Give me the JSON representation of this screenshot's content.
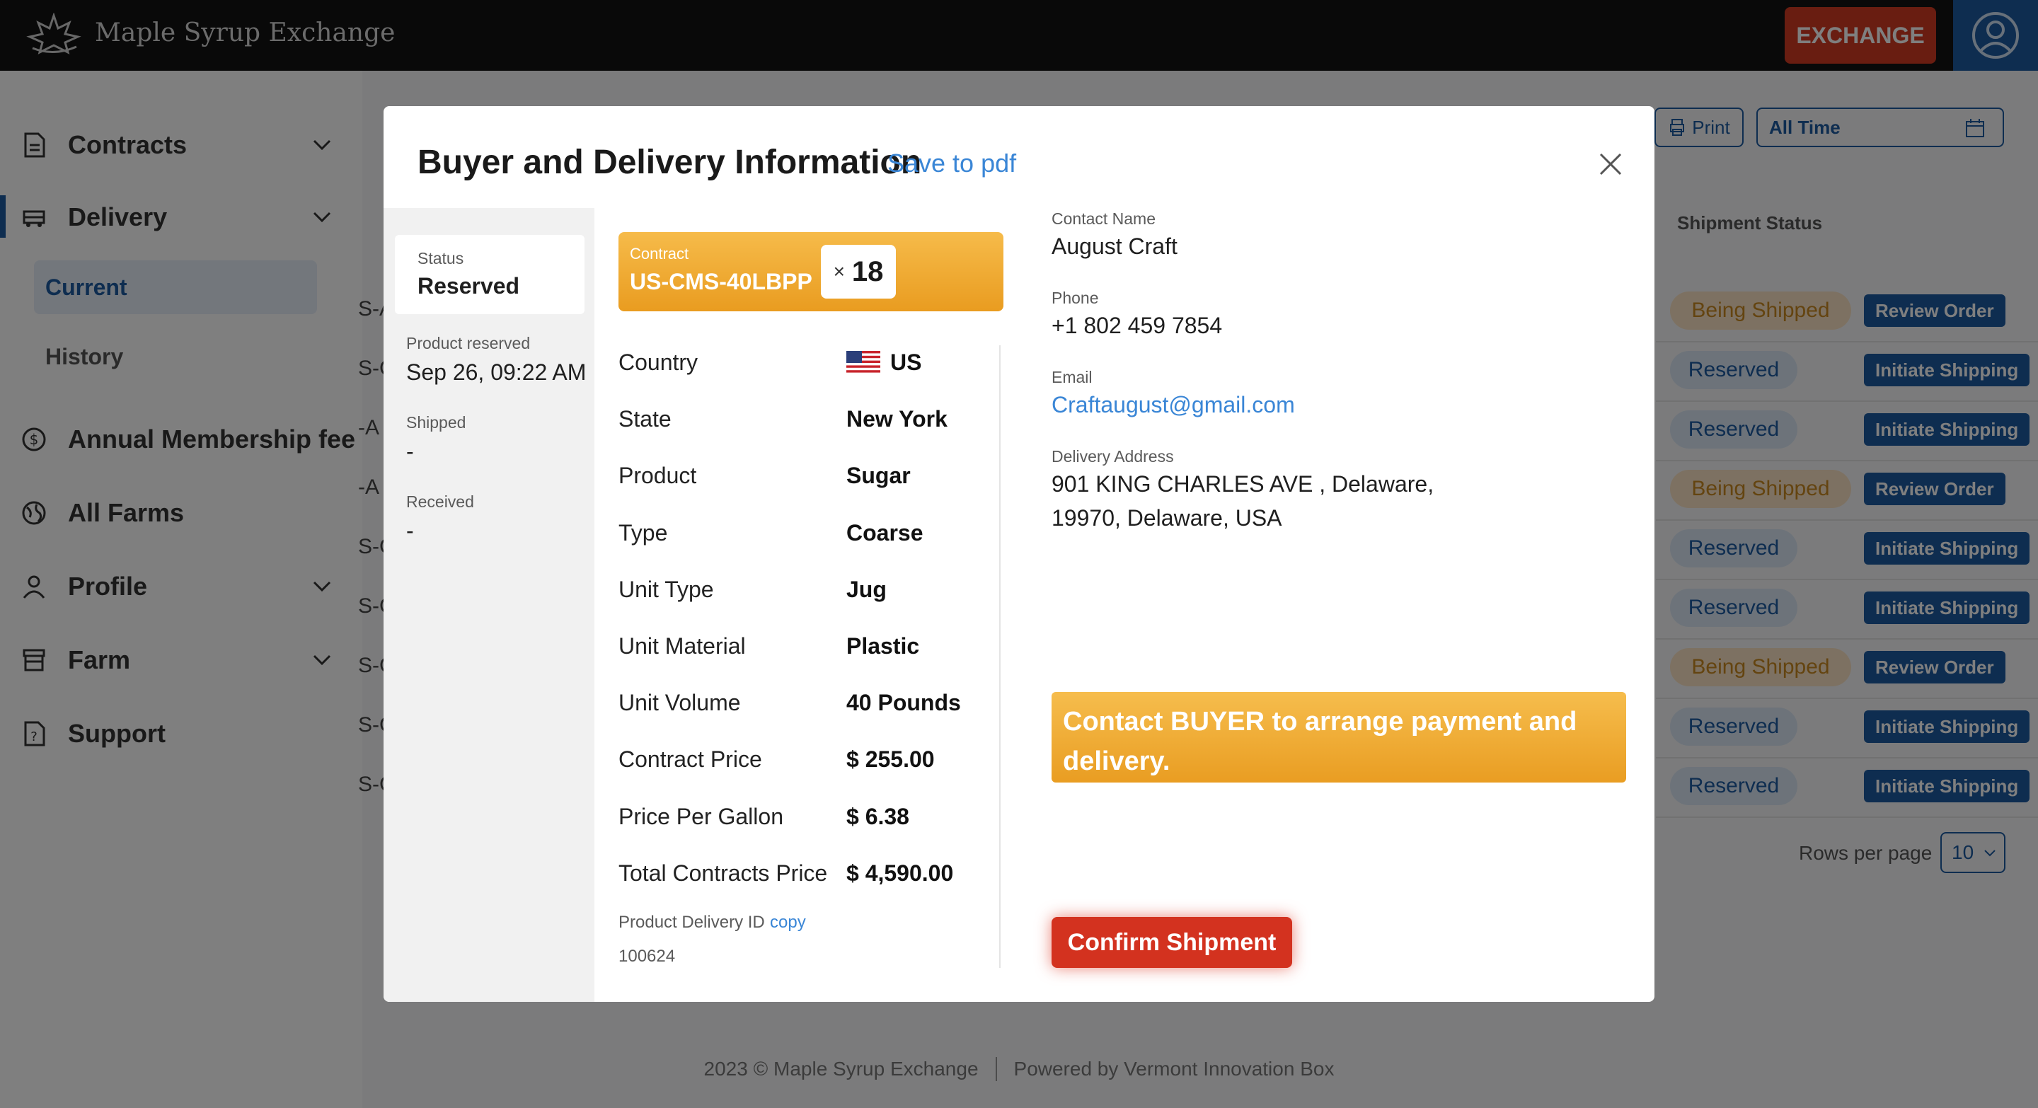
{
  "app": {
    "title": "Maple Syrup Exchange",
    "exchange_label": "EXCHANGE"
  },
  "sidebar": {
    "items": [
      {
        "label": "Contracts",
        "icon": "document-icon"
      },
      {
        "label": "Delivery",
        "icon": "truck-icon"
      },
      {
        "label": "Annual Membership fee",
        "icon": "dollar-circle-icon"
      },
      {
        "label": "All Farms",
        "icon": "globe-icon"
      },
      {
        "label": "Profile",
        "icon": "person-icon"
      },
      {
        "label": "Farm",
        "icon": "store-icon"
      },
      {
        "label": "Support",
        "icon": "help-document-icon"
      }
    ],
    "delivery_sub": [
      "Current",
      "History"
    ]
  },
  "toolbar": {
    "print_label": "Print",
    "time_filter": "All Time"
  },
  "table": {
    "status_header": "Shipment Status",
    "rows": [
      {
        "status": "Being Shipped",
        "action": "Review Order"
      },
      {
        "status": "Reserved",
        "action": "Initiate Shipping"
      },
      {
        "status": "Reserved",
        "action": "Initiate Shipping"
      },
      {
        "status": "Being Shipped",
        "action": "Review Order"
      },
      {
        "status": "Reserved",
        "action": "Initiate Shipping"
      },
      {
        "status": "Reserved",
        "action": "Initiate Shipping"
      },
      {
        "status": "Being Shipped",
        "action": "Review Order"
      },
      {
        "status": "Reserved",
        "action": "Initiate Shipping"
      },
      {
        "status": "Reserved",
        "action": "Initiate Shipping"
      }
    ],
    "left_cut": [
      "S-A",
      "S-C",
      "-A",
      "-A",
      "S-C",
      "S-C",
      "S-C",
      "S-C",
      "S-C"
    ],
    "rows_per_page_label": "Rows per page",
    "rows_per_page": "10"
  },
  "footer": {
    "copyright": "2023 © Maple Syrup Exchange",
    "powered": "Powered by Vermont Innovation Box"
  },
  "modal": {
    "title": "Buyer and Delivery Information",
    "save_pdf": "Save to pdf",
    "status_label": "Status",
    "status_value": "Reserved",
    "product_reserved_label": "Product reserved",
    "product_reserved_value": "Sep 26, 09:22 AM",
    "shipped_label": "Shipped",
    "shipped_value": "-",
    "received_label": "Received",
    "received_value": "-",
    "contract_label": "Contract",
    "contract_id": "US-CMS-40LBPP",
    "qty_prefix": "×",
    "qty": "18",
    "details": [
      {
        "key": "Country",
        "value": "US"
      },
      {
        "key": "State",
        "value": "New York"
      },
      {
        "key": "Product",
        "value": "Sugar"
      },
      {
        "key": "Type",
        "value": "Coarse"
      },
      {
        "key": "Unit Type",
        "value": "Jug"
      },
      {
        "key": "Unit Material",
        "value": "Plastic"
      },
      {
        "key": "Unit Volume",
        "value": "40 Pounds"
      },
      {
        "key": "Contract Price",
        "value": "$ 255.00"
      },
      {
        "key": "Price Per Gallon",
        "value": "$ 6.38"
      },
      {
        "key": "Total Contracts Price",
        "value": "$ 4,590.00"
      }
    ],
    "delivery_id_label": "Product Delivery ID",
    "copy_label": "copy",
    "delivery_id": "100624",
    "contact_name_label": "Contact Name",
    "contact_name": "August Craft",
    "phone_label": "Phone",
    "phone": "+1 802 459 7854",
    "email_label": "Email",
    "email": "Craftaugust@gmail.com",
    "address_label": "Delivery Address",
    "address_line1": "901 KING CHARLES AVE , Delaware,",
    "address_line2": "19970, Delaware, USA",
    "notice": "Contact BUYER to arrange payment and delivery.",
    "confirm_label": "Confirm Shipment"
  }
}
